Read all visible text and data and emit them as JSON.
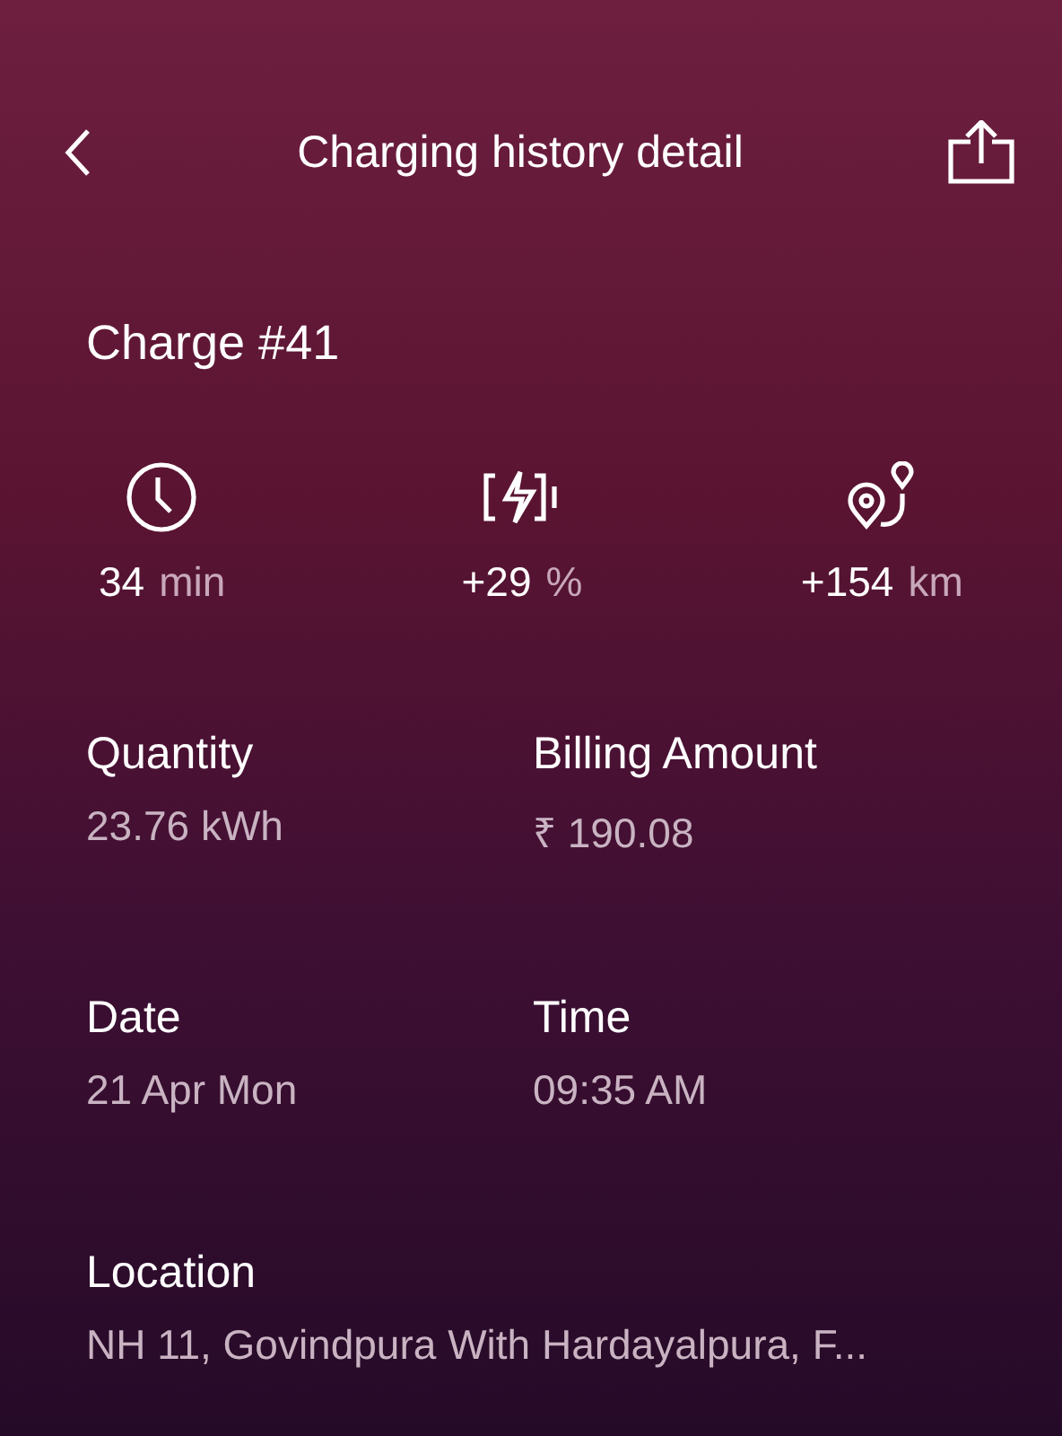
{
  "header": {
    "title": "Charging history detail"
  },
  "charge_title": "Charge #41",
  "stats": [
    {
      "kind": "duration",
      "value": "34",
      "unit": "min"
    },
    {
      "kind": "battery",
      "value": "+29",
      "unit": "%"
    },
    {
      "kind": "range",
      "value": "+154",
      "unit": "km"
    }
  ],
  "details": [
    {
      "label": "Quantity",
      "value": "23.76 kWh"
    },
    {
      "label": "Billing Amount",
      "value": "₹ 190.08"
    },
    {
      "label": "Date",
      "value": "21 Apr Mon"
    },
    {
      "label": "Time",
      "value": "09:35 AM"
    }
  ],
  "location": {
    "label": "Location",
    "value": "NH 11, Govindpura With Hardayalpura, F..."
  }
}
